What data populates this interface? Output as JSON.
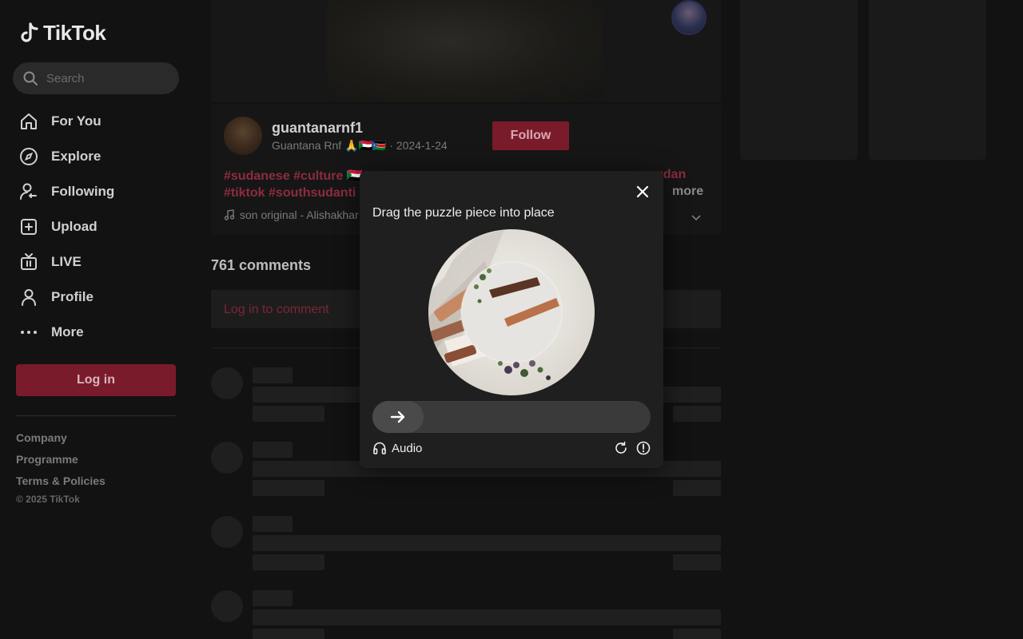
{
  "sidebar": {
    "brand": "TikTok",
    "search_placeholder": "Search",
    "nav": [
      {
        "label": "For You",
        "icon": "home-icon"
      },
      {
        "label": "Explore",
        "icon": "compass-icon"
      },
      {
        "label": "Following",
        "icon": "following-icon"
      },
      {
        "label": "Upload",
        "icon": "upload-icon"
      },
      {
        "label": "LIVE",
        "icon": "live-icon"
      },
      {
        "label": "Profile",
        "icon": "profile-icon"
      },
      {
        "label": "More",
        "icon": "more-icon"
      }
    ],
    "login_label": "Log in",
    "footer_links": [
      "Company",
      "Programme",
      "Terms & Policies"
    ],
    "copyright": "© 2025 TikTok"
  },
  "post": {
    "author_username": "guantanarnf1",
    "author_display": "Guantana Rnf 🙏🇸🇩🇸🇸",
    "date": "2024-1-24",
    "follow_label": "Follow",
    "caption_line1": "#sudanese #culture 🇸🇩",
    "caption_tail": "udan",
    "caption_line2": "#tiktok #southsudanti",
    "more_label": "more",
    "music": "son original - Alishakhar"
  },
  "comments": {
    "count_label": "761 comments",
    "login_prompt": "Log in to comment"
  },
  "captcha": {
    "title": "Drag the puzzle piece into place",
    "audio_label": "Audio"
  },
  "colors": {
    "brand_red": "#fe2c55",
    "background": "#121212"
  }
}
